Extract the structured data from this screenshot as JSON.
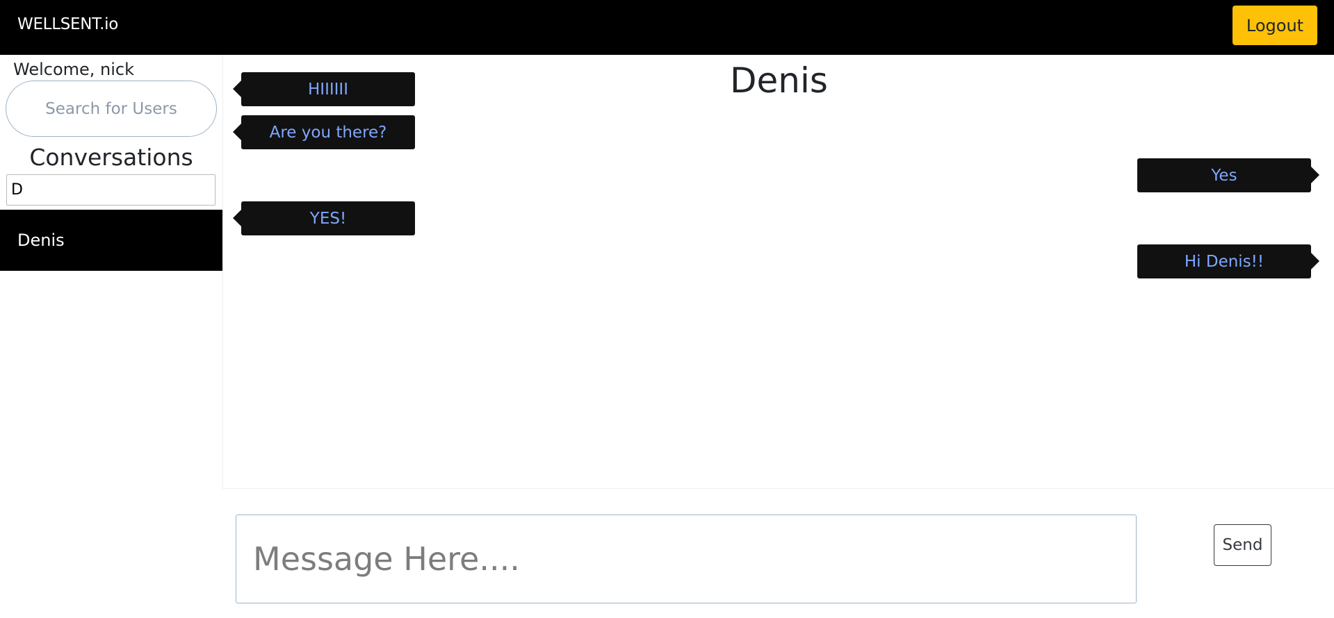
{
  "navbar": {
    "brand": "WELLSENT.io",
    "logout_label": "Logout"
  },
  "sidebar": {
    "welcome_text": "Welcome, nick",
    "search_placeholder": "Search for Users",
    "conversations_title": "Conversations",
    "filter_value": "D",
    "conversations": [
      {
        "name": "Denis",
        "active": true
      }
    ]
  },
  "chat": {
    "title": "Denis",
    "messages": [
      {
        "text": "HIIIIII",
        "direction": "incoming"
      },
      {
        "text": "Are you there?",
        "direction": "incoming"
      },
      {
        "text": "Yes",
        "direction": "outgoing"
      },
      {
        "text": "YES!",
        "direction": "incoming"
      },
      {
        "text": "Hi Denis!!",
        "direction": "outgoing"
      }
    ]
  },
  "composer": {
    "placeholder": "Message Here....",
    "value": "",
    "send_label": "Send"
  },
  "colors": {
    "navbar_bg": "#000000",
    "logout_bg": "#ffc107",
    "bubble_bg": "#111111",
    "bubble_text": "#7fa7ff",
    "active_conversation_bg": "#000000"
  }
}
